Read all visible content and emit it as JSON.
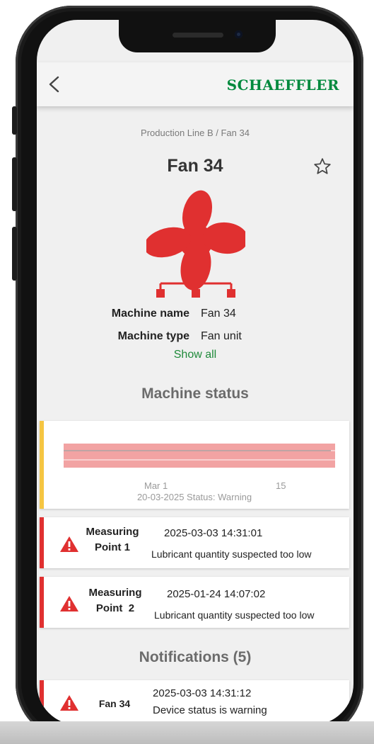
{
  "header": {
    "brand": "SCHAEFFLER"
  },
  "breadcrumb": "Production Line B / Fan 34",
  "title": "Fan 34",
  "machine": {
    "rows": [
      {
        "label": "Machine name",
        "value": "Fan 34"
      },
      {
        "label": "Machine type",
        "value": "Fan unit"
      }
    ],
    "show_all": "Show all"
  },
  "status_section": {
    "title": "Machine status",
    "chart": {
      "tick_labels": [
        "Mar 1",
        "15"
      ],
      "caption": "20-03-2025 Status: Warning",
      "accent": "#f5c542",
      "band_color": "#f2a3a3"
    }
  },
  "measuring_points": [
    {
      "name_line1": "Measuring",
      "name_line2": "Point 1",
      "timestamp": "2025-03-03 14:31:01",
      "message": "Lubricant quantity suspected too low"
    },
    {
      "name_line1": "Measuring",
      "name_line2": "Point  2",
      "timestamp": "2025-01-24 14:07:02",
      "message": "Lubricant quantity suspected too low"
    }
  ],
  "notifications": {
    "title": "Notifications (5)",
    "items": [
      {
        "name": "Fan 34",
        "timestamp": "2025-03-03 14:31:12",
        "message": "Device status is warning"
      }
    ]
  },
  "colors": {
    "brand": "#00893d",
    "alert": "#e03030",
    "warning_stripe": "#f5c542",
    "link": "#1f8a3a"
  },
  "icons": [
    "back-arrow-icon",
    "star-outline-icon",
    "fan-machine-icon",
    "warning-triangle-icon"
  ]
}
